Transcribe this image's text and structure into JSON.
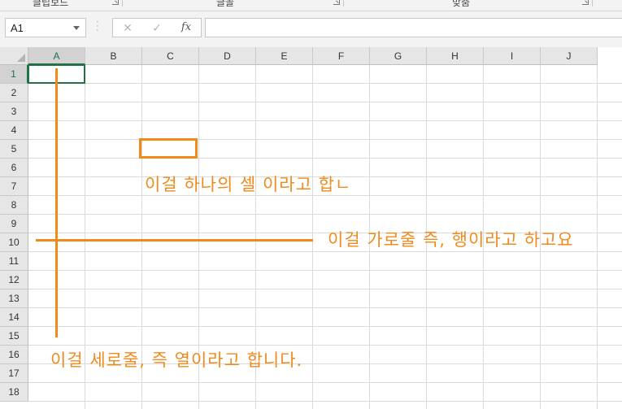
{
  "ribbon_groups": [
    {
      "label": "클립보드"
    },
    {
      "label": "글꼴"
    },
    {
      "label": "맞춤"
    }
  ],
  "formula_bar": {
    "name_box": "A1",
    "cancel_icon": "✕",
    "enter_icon": "✓",
    "fx_label": "fx",
    "formula_value": ""
  },
  "columns": [
    "A",
    "B",
    "C",
    "D",
    "E",
    "F",
    "G",
    "H",
    "I",
    "J"
  ],
  "rows": [
    "1",
    "2",
    "3",
    "4",
    "5",
    "6",
    "7",
    "8",
    "9",
    "10",
    "11",
    "12",
    "13",
    "14",
    "15",
    "16",
    "17",
    "18"
  ],
  "active_cell": "A1",
  "annotations": {
    "cell_text": "이걸 하나의 셀 이라고 합ㄴ",
    "row_text": "이걸 가로줄 즉, 행이라고 하고요",
    "column_text": "이걸 세로줄, 즉 열이라고 합니다.",
    "color": "#f08a1c"
  },
  "colors": {
    "header_bg": "#e6e6e6",
    "gridline": "#dadada",
    "selection": "#217346"
  }
}
